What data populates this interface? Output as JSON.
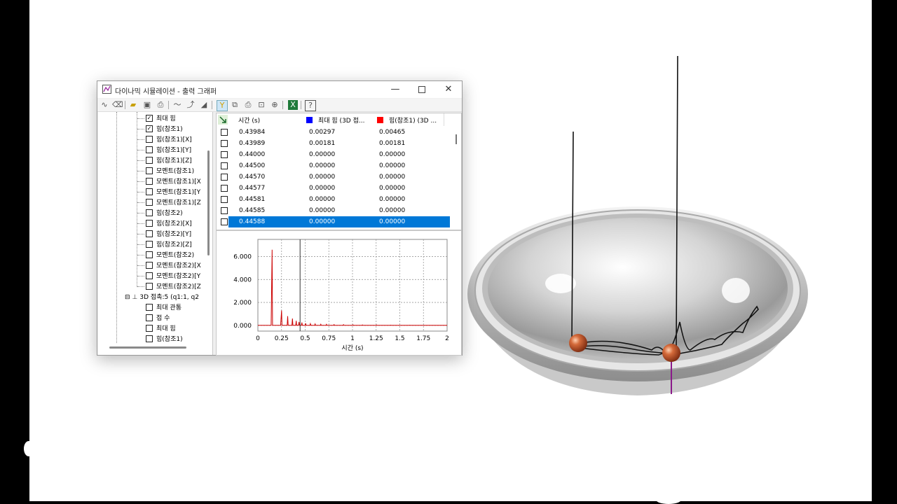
{
  "window": {
    "title": "다이나믹 시뮬레이션 - 출력 그래퍼",
    "minimize": "—",
    "close": "✕"
  },
  "toolbar": {
    "icons": [
      "wave-icon",
      "eraser-icon",
      "open-folder-icon",
      "save-icon",
      "save-as-icon",
      "curve-icon",
      "trend-icon",
      "area-icon",
      "filter-icon",
      "copy-icon",
      "print-icon",
      "zoom-fit-icon",
      "zoom-icon",
      "excel-icon",
      "help-icon"
    ]
  },
  "tree": {
    "items": [
      {
        "label": "최대 힘",
        "checked": true
      },
      {
        "label": "힘(참조1)",
        "checked": true
      },
      {
        "label": "힘(참조1)[X]",
        "checked": false
      },
      {
        "label": "힘(참조1)[Y]",
        "checked": false
      },
      {
        "label": "힘(참조1)[Z]",
        "checked": false
      },
      {
        "label": "모멘트(참조1)",
        "checked": false
      },
      {
        "label": "모멘트(참조1)[X",
        "checked": false
      },
      {
        "label": "모멘트(참조1)[Y",
        "checked": false
      },
      {
        "label": "모멘트(참조1)[Z",
        "checked": false
      },
      {
        "label": "힘(참조2)",
        "checked": false
      },
      {
        "label": "힘(참조2)[X]",
        "checked": false
      },
      {
        "label": "힘(참조2)[Y]",
        "checked": false
      },
      {
        "label": "힘(참조2)[Z]",
        "checked": false
      },
      {
        "label": "모멘트(참조2)",
        "checked": false
      },
      {
        "label": "모멘트(참조2)[X",
        "checked": false
      },
      {
        "label": "모멘트(참조2)[Y",
        "checked": false
      },
      {
        "label": "모멘트(참조2)[Z",
        "checked": false
      }
    ],
    "group": {
      "toggle": "⊟",
      "label": "3D 접촉:5 (q1:1, q2"
    },
    "subitems": [
      {
        "label": "최대 관통",
        "checked": false
      },
      {
        "label": "접 수",
        "checked": false
      },
      {
        "label": "최대 힘",
        "checked": false
      },
      {
        "label": "힘(참조1)",
        "checked": false
      }
    ]
  },
  "table": {
    "headers": [
      "시간 (s)",
      "최대 힘 (3D 접...",
      "힘(참조1) (3D ..."
    ],
    "header_colors": [
      "#0000ff",
      "#ff0000"
    ],
    "rows": [
      [
        "0.43984",
        "0.00297",
        "0.00465"
      ],
      [
        "0.43989",
        "0.00181",
        "0.00181"
      ],
      [
        "0.44000",
        "0.00000",
        "0.00000"
      ],
      [
        "0.44500",
        "0.00000",
        "0.00000"
      ],
      [
        "0.44570",
        "0.00000",
        "0.00000"
      ],
      [
        "0.44577",
        "0.00000",
        "0.00000"
      ],
      [
        "0.44581",
        "0.00000",
        "0.00000"
      ],
      [
        "0.44585",
        "0.00000",
        "0.00000"
      ],
      [
        "0.44588",
        "0.00000",
        "0.00000"
      ]
    ],
    "selected_row": 8
  },
  "chart_data": {
    "type": "line",
    "xlabel": "시간 (s)",
    "ylabel": "",
    "xlim": [
      0,
      2
    ],
    "ylim": [
      -500,
      7500
    ],
    "xticks": [
      "0",
      "0.25",
      "0.5",
      "0.75",
      "1",
      "1.25",
      "1.5",
      "1.75",
      "2"
    ],
    "yticks": [
      "6.000",
      "4.000",
      "2.000",
      "0.000"
    ],
    "ytick_values": [
      6000,
      4000,
      2000,
      0
    ],
    "grid": true,
    "cursor_x": 0.44588,
    "series": [
      {
        "color": "#cc0000",
        "x": [
          0,
          0.14,
          0.15,
          0.155,
          0.16,
          0.24,
          0.25,
          0.255,
          0.26,
          0.31,
          0.315,
          0.32,
          0.36,
          0.365,
          0.37,
          0.4,
          0.405,
          0.41,
          0.43,
          0.435,
          0.44,
          0.46,
          0.465,
          0.47,
          0.5,
          0.505,
          0.51,
          0.55,
          0.555,
          0.56,
          0.6,
          0.605,
          0.61,
          0.66,
          0.665,
          0.67,
          0.72,
          0.725,
          0.73,
          0.8,
          0.805,
          0.81,
          0.9,
          0.905,
          0.91,
          1.0,
          1.005,
          1.01,
          1.1,
          1.105,
          1.11,
          1.25,
          1.255,
          1.26,
          1.4,
          1.405,
          1.41,
          1.6,
          1.605,
          1.61,
          2.0
        ],
        "y": [
          0,
          0,
          6600,
          0,
          0,
          0,
          1300,
          0,
          0,
          0,
          800,
          0,
          0,
          600,
          0,
          0,
          400,
          0,
          0,
          300,
          0,
          0,
          250,
          0,
          0,
          180,
          0,
          0,
          150,
          0,
          0,
          120,
          0,
          0,
          100,
          0,
          0,
          90,
          0,
          0,
          70,
          0,
          0,
          60,
          0,
          0,
          50,
          0,
          0,
          40,
          0,
          0,
          30,
          0,
          0,
          25,
          0,
          0,
          20,
          0,
          0
        ]
      }
    ]
  }
}
